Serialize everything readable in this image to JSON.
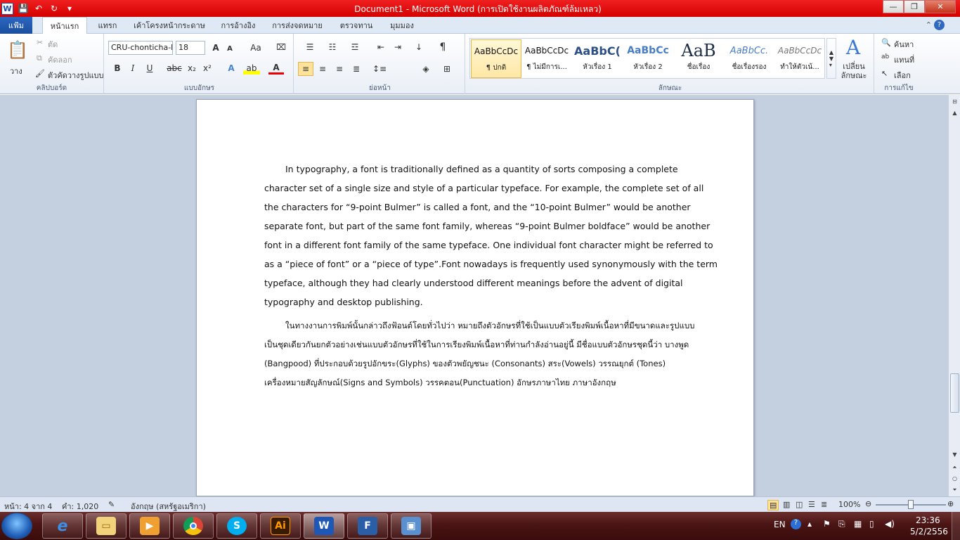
{
  "app": {
    "title": "Document1  -  Microsoft Word (การเปิดใช้งานผลิตภัณฑ์ล้มเหลว)",
    "logo_letter": "W"
  },
  "window_controls": {
    "minimize": "—",
    "maximize": "❐",
    "close": "✕"
  },
  "tabs": {
    "file": "แฟ้ม",
    "items": [
      "หน้าแรก",
      "แทรก",
      "เค้าโครงหน้ากระดาษ",
      "การอ้างอิง",
      "การส่งจดหมาย",
      "ตรวจทาน",
      "มุมมอง"
    ]
  },
  "ribbon": {
    "clipboard": {
      "paste": "วาง",
      "cut": "ตัด",
      "copy": "คัดลอก",
      "format_painter": "ตัวคัดวางรูปแบบ",
      "label": "คลิปบอร์ด"
    },
    "font": {
      "name": "CRU-chonticha-h",
      "size": "18",
      "label": "แบบอักษร",
      "bold": "B",
      "italic": "I",
      "underline": "U",
      "strike": "abc",
      "subscript": "x₂",
      "superscript": "x²",
      "grow": "A",
      "shrink": "A",
      "case": "Aa"
    },
    "paragraph": {
      "label": "ย่อหน้า",
      "pilcrow": "¶"
    },
    "styles": {
      "label": "ลักษณะ",
      "items": [
        {
          "sample": "AaBbCcDc",
          "name": "¶ ปกติ"
        },
        {
          "sample": "AaBbCcDc",
          "name": "¶ ไม่มีการเ..."
        },
        {
          "sample": "AaBbC(",
          "name": "หัวเรื่อง 1"
        },
        {
          "sample": "AaBbCc",
          "name": "หัวเรื่อง 2"
        },
        {
          "sample": "AaB",
          "name": "ชื่อเรื่อง"
        },
        {
          "sample": "AaBbCc.",
          "name": "ชื่อเรื่องรอง"
        },
        {
          "sample": "AaBbCcDc",
          "name": "ทำให้ตัวเน้..."
        }
      ],
      "change_styles": "เปลี่ยน ลักษณะ"
    },
    "editing": {
      "label": "การแก้ไข",
      "find": "ค้นหา",
      "replace": "แทนที่",
      "select": "เลือก"
    }
  },
  "document": {
    "paragraph1": [
      "In typography, a font is traditionally defined as a quantity of sorts composing a complete",
      "character set of a single size and style of a particular typeface. For example, the complete set of all",
      "the characters for “9-point Bulmer” is called a font, and the “10-point Bulmer” would be another",
      "separate font, but part of the same font family, whereas “9-point Bulmer boldface” would be another",
      "font in a different font family of the same typeface.  One individual font character might be referred to",
      "as a “piece of font” or a “piece of type”.Font nowadays is frequently used synonymously with the term",
      "typeface, although they had clearly understood different meanings before the advent of digital",
      "typography and desktop publishing."
    ],
    "paragraph2": [
      "ในทางงานการพิมพ์นั้นกล่าวถึงฟ้อนต์โดยทั่วไปว่า หมายถึงตัวอักษรที่ใช้เป็นแบบตัวเรียงพิมพ์เนื้อหาที่มีขนาดและรูปแบบ",
      "เป็นชุดเดียวกันยกตัวอย่างเช่นแบบตัวอักษรที่ใช้ในการเรียงพิมพ์เนื้อหาที่ท่านกำลังอ่านอยู่นี้ มีชื่อแบบตัวอักษรชุดนี้ว่า บางพูด",
      "(Bangpood) ที่ประกอบด้วยรูปอักขระ(Glyphs) ของตัวพยัญชนะ (Consonants) สระ(Vowels) วรรณยุกต์ (Tones)",
      "เครื่องหมายสัญลักษณ์(Signs and Symbols) วรรคตอน(Punctuation) อักษรภาษาไทย ภาษาอังกฤษ"
    ]
  },
  "status": {
    "page": "หน้า: 4 จาก 4",
    "words": "คำ: 1,020",
    "language": "อังกฤษ (สหรัฐอเมริกา)",
    "zoom": "100%",
    "zoom_fraction": 0.5
  },
  "taskbar": {
    "apps": [
      "ie",
      "explorer",
      "media",
      "chrome",
      "skype",
      "illustrator",
      "word",
      "flash",
      "remote"
    ],
    "illustrator": "Ai",
    "word": "W",
    "flash": "F",
    "lang": "EN",
    "time": "23:36",
    "date": "5/2/2556"
  }
}
